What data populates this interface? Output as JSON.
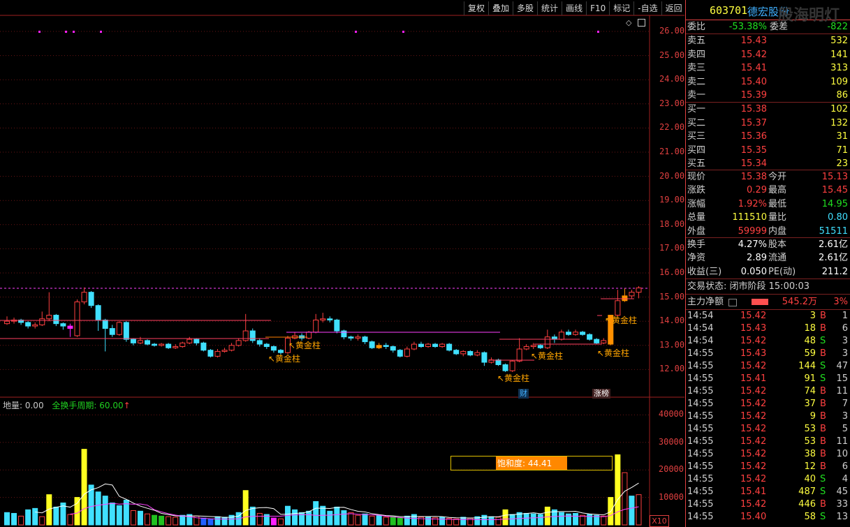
{
  "toolbar": [
    "复权",
    "叠加",
    "多股",
    "统计",
    "画线",
    "F10",
    "标记",
    "-自选",
    "返回"
  ],
  "price_axis": [
    "26.00",
    "25.00",
    "24.00",
    "23.00",
    "22.00",
    "21.00",
    "20.00",
    "19.00",
    "18.00",
    "17.00",
    "16.00",
    "15.00",
    "14.00",
    "13.00",
    "12.00"
  ],
  "volume_axis": [
    "40000",
    "30000",
    "20000",
    "10000"
  ],
  "volume_header": {
    "label": "地量: 0.00",
    "indicator": "全换手周期: 60.00",
    "arrow": "↑"
  },
  "golden_labels": [
    "↖黄金柱",
    "↖黄金柱",
    "↖黄金柱",
    "↖黄金柱",
    "↖黄金柱",
    "↖黄金柱"
  ],
  "event_tags": {
    "cai": "财",
    "zhangbang": "涨榜"
  },
  "saturation": "饱和度: 44.41",
  "x10_label": "X10",
  "stock": {
    "code": "603701",
    "name": "德宏股份",
    "watermark": "股海明灯"
  },
  "weibi": {
    "label1": "委比",
    "value1": "-53.38%",
    "label2": "委差",
    "value2": "-822"
  },
  "asks": [
    {
      "label": "卖五",
      "price": "15.43",
      "vol": "532"
    },
    {
      "label": "卖四",
      "price": "15.42",
      "vol": "141"
    },
    {
      "label": "卖三",
      "price": "15.41",
      "vol": "313"
    },
    {
      "label": "卖二",
      "price": "15.40",
      "vol": "109"
    },
    {
      "label": "卖一",
      "price": "15.39",
      "vol": "86"
    }
  ],
  "bids": [
    {
      "label": "买一",
      "price": "15.38",
      "vol": "102"
    },
    {
      "label": "买二",
      "price": "15.37",
      "vol": "132"
    },
    {
      "label": "买三",
      "price": "15.36",
      "vol": "31"
    },
    {
      "label": "买四",
      "price": "15.35",
      "vol": "71"
    },
    {
      "label": "买五",
      "price": "15.34",
      "vol": "23"
    }
  ],
  "quote": [
    {
      "l1": "现价",
      "v1": "15.38",
      "l2": "今开",
      "v2": "15.13"
    },
    {
      "l1": "涨跌",
      "v1": "0.29",
      "l2": "最高",
      "v2": "15.45"
    },
    {
      "l1": "涨幅",
      "v1": "1.92%",
      "l2": "最低",
      "v2": "14.95"
    },
    {
      "l1": "总量",
      "v1": "111510",
      "l2": "量比",
      "v2": "0.80"
    },
    {
      "l1": "外盘",
      "v1": "59999",
      "l2": "内盘",
      "v2": "51511"
    }
  ],
  "fundamentals": [
    {
      "l1": "换手",
      "v1": "4.27%",
      "l2": "股本",
      "v2": "2.61亿"
    },
    {
      "l1": "净资",
      "v1": "2.89",
      "l2": "流通",
      "v2": "2.61亿"
    },
    {
      "l1": "收益(三)",
      "v1": "0.050",
      "l2": "PE(动)",
      "v2": "211.2"
    }
  ],
  "trade_state": "交易状态: 闭市阶段 15:00:03",
  "main_flow": {
    "label": "主力净额",
    "value": "545.2万",
    "pct": "3%"
  },
  "ticks": [
    {
      "t": "14:54",
      "p": "15.42",
      "v": "3",
      "bs": "B",
      "n": "1"
    },
    {
      "t": "14:54",
      "p": "15.43",
      "v": "18",
      "bs": "B",
      "n": "6"
    },
    {
      "t": "14:54",
      "p": "15.42",
      "v": "48",
      "bs": "S",
      "n": "3"
    },
    {
      "t": "14:55",
      "p": "15.43",
      "v": "59",
      "bs": "B",
      "n": "3"
    },
    {
      "t": "14:55",
      "p": "15.42",
      "v": "144",
      "bs": "S",
      "n": "47"
    },
    {
      "t": "14:55",
      "p": "15.41",
      "v": "91",
      "bs": "S",
      "n": "15"
    },
    {
      "t": "14:55",
      "p": "15.42",
      "v": "74",
      "bs": "B",
      "n": "11"
    },
    {
      "t": "14:55",
      "p": "15.42",
      "v": "37",
      "bs": "B",
      "n": "7"
    },
    {
      "t": "14:55",
      "p": "15.42",
      "v": "9",
      "bs": "B",
      "n": "3"
    },
    {
      "t": "14:55",
      "p": "15.42",
      "v": "53",
      "bs": "B",
      "n": "5"
    },
    {
      "t": "14:55",
      "p": "15.42",
      "v": "53",
      "bs": "B",
      "n": "11"
    },
    {
      "t": "14:55",
      "p": "15.42",
      "v": "38",
      "bs": "B",
      "n": "10"
    },
    {
      "t": "14:55",
      "p": "15.42",
      "v": "12",
      "bs": "B",
      "n": "6"
    },
    {
      "t": "14:55",
      "p": "15.42",
      "v": "40",
      "bs": "S",
      "n": "4"
    },
    {
      "t": "14:55",
      "p": "15.41",
      "v": "487",
      "bs": "S",
      "n": "45"
    },
    {
      "t": "14:55",
      "p": "15.42",
      "v": "446",
      "bs": "B",
      "n": "33"
    },
    {
      "t": "14:55",
      "p": "15.40",
      "v": "58",
      "bs": "S",
      "n": "13"
    }
  ],
  "candles": [
    [
      13.9,
      14.0,
      14.2,
      13.85
    ],
    [
      14.0,
      14.05,
      14.15,
      13.9
    ],
    [
      14.05,
      13.95,
      14.1,
      13.85
    ],
    [
      13.95,
      13.8,
      14.0,
      13.7
    ],
    [
      13.8,
      13.85,
      13.95,
      13.7
    ],
    [
      13.85,
      14.1,
      14.4,
      13.8
    ],
    [
      14.1,
      14.25,
      15.2,
      14.0
    ],
    [
      14.25,
      13.9,
      14.3,
      13.8
    ],
    [
      13.9,
      13.8,
      13.95,
      13.65
    ],
    [
      13.8,
      13.7,
      13.9,
      13.35
    ],
    [
      13.4,
      14.8,
      14.9,
      13.35
    ],
    [
      14.8,
      15.2,
      15.4,
      14.7
    ],
    [
      15.2,
      14.65,
      15.25,
      14.55
    ],
    [
      14.65,
      14.05,
      14.7,
      13.6
    ],
    [
      14.05,
      13.7,
      14.1,
      12.75
    ],
    [
      13.7,
      13.45,
      13.85,
      13.35
    ],
    [
      13.45,
      13.95,
      14.0,
      13.4
    ],
    [
      13.95,
      13.25,
      14.0,
      13.15
    ],
    [
      13.25,
      13.1,
      13.3,
      13.0
    ],
    [
      13.1,
      13.2,
      13.35,
      13.05
    ],
    [
      13.2,
      13.05,
      13.25,
      13.0
    ],
    [
      13.05,
      13.0,
      13.1,
      12.95
    ],
    [
      13.0,
      13.05,
      13.1,
      12.95
    ],
    [
      13.05,
      12.9,
      13.1,
      12.85
    ],
    [
      12.9,
      12.95,
      13.05,
      12.85
    ],
    [
      12.95,
      13.1,
      13.15,
      12.9
    ],
    [
      13.1,
      13.25,
      13.35,
      13.05
    ],
    [
      13.25,
      13.1,
      13.3,
      13.0
    ],
    [
      13.1,
      12.8,
      13.15,
      12.75
    ],
    [
      12.8,
      12.55,
      12.85,
      12.5
    ],
    [
      12.55,
      12.75,
      12.85,
      12.5
    ],
    [
      12.75,
      12.8,
      12.9,
      12.7
    ],
    [
      12.8,
      13.0,
      13.1,
      12.75
    ],
    [
      13.0,
      13.2,
      13.3,
      12.95
    ],
    [
      13.2,
      13.6,
      14.3,
      13.15
    ],
    [
      13.6,
      13.2,
      13.7,
      13.1
    ],
    [
      13.2,
      13.05,
      13.3,
      12.95
    ],
    [
      13.05,
      12.95,
      13.1,
      12.85
    ],
    [
      12.95,
      12.8,
      13.0,
      12.7
    ],
    [
      12.8,
      12.7,
      12.85,
      12.6
    ],
    [
      12.7,
      13.3,
      13.4,
      12.65
    ],
    [
      13.3,
      13.4,
      13.55,
      13.25
    ],
    [
      13.4,
      13.3,
      13.5,
      13.2
    ],
    [
      13.3,
      13.55,
      13.6,
      13.25
    ],
    [
      13.55,
      14.05,
      14.3,
      13.5
    ],
    [
      14.05,
      14.1,
      14.35,
      13.95
    ],
    [
      14.1,
      14.05,
      14.2,
      13.95
    ],
    [
      14.05,
      13.6,
      14.1,
      13.5
    ],
    [
      13.6,
      13.35,
      13.65,
      13.25
    ],
    [
      13.35,
      13.3,
      13.4,
      13.2
    ],
    [
      13.3,
      13.35,
      13.45,
      13.2
    ],
    [
      13.35,
      13.15,
      13.4,
      13.05
    ],
    [
      13.15,
      12.9,
      13.2,
      12.85
    ],
    [
      12.9,
      13.0,
      13.1,
      12.85
    ],
    [
      13.0,
      12.95,
      13.1,
      12.85
    ],
    [
      12.95,
      12.8,
      13.0,
      12.7
    ],
    [
      12.8,
      12.55,
      12.85,
      12.5
    ],
    [
      12.55,
      12.85,
      12.95,
      12.5
    ],
    [
      12.85,
      13.05,
      13.15,
      12.8
    ],
    [
      13.05,
      12.95,
      13.15,
      12.9
    ],
    [
      12.95,
      13.05,
      13.1,
      12.9
    ],
    [
      13.05,
      12.95,
      13.1,
      12.9
    ],
    [
      12.95,
      13.05,
      13.1,
      12.9
    ],
    [
      13.05,
      12.8,
      13.1,
      12.75
    ],
    [
      12.8,
      12.65,
      12.85,
      12.6
    ],
    [
      12.65,
      12.75,
      12.8,
      12.55
    ],
    [
      12.75,
      12.6,
      12.8,
      12.55
    ],
    [
      12.6,
      12.7,
      12.8,
      12.55
    ],
    [
      12.7,
      12.3,
      12.75,
      12.15
    ],
    [
      12.3,
      12.4,
      12.5,
      12.25
    ],
    [
      12.4,
      12.2,
      12.45,
      12.15
    ],
    [
      12.2,
      11.95,
      12.25,
      11.9
    ],
    [
      11.95,
      12.35,
      12.4,
      11.9
    ],
    [
      12.35,
      12.85,
      13.3,
      12.3
    ],
    [
      12.85,
      12.95,
      13.05,
      12.8
    ],
    [
      12.95,
      13.0,
      13.1,
      12.85
    ],
    [
      13.0,
      12.9,
      13.05,
      12.85
    ],
    [
      12.9,
      13.35,
      13.65,
      12.85
    ],
    [
      13.35,
      13.25,
      13.45,
      13.1
    ],
    [
      13.25,
      13.55,
      13.65,
      13.2
    ],
    [
      13.55,
      13.45,
      13.65,
      13.4
    ],
    [
      13.45,
      13.55,
      13.65,
      13.4
    ],
    [
      13.55,
      13.45,
      13.6,
      13.4
    ],
    [
      13.45,
      13.25,
      13.5,
      13.2
    ],
    [
      13.25,
      13.1,
      13.3,
      13.05
    ],
    [
      13.1,
      13.2,
      13.3,
      13.05
    ],
    [
      13.05,
      14.25,
      14.25,
      13.0
    ],
    [
      14.25,
      14.85,
      15.3,
      14.2
    ],
    [
      14.85,
      15.05,
      15.35,
      14.8
    ],
    [
      15.05,
      15.2,
      15.3,
      14.95
    ],
    [
      15.2,
      15.38,
      15.45,
      14.95
    ]
  ],
  "volumes": [
    [
      4500,
      "u"
    ],
    [
      4200,
      "u"
    ],
    [
      3200,
      "d"
    ],
    [
      5500,
      "u"
    ],
    [
      6000,
      "u"
    ],
    [
      3000,
      "d"
    ],
    [
      11000,
      "y"
    ],
    [
      6500,
      "u"
    ],
    [
      8000,
      "u"
    ],
    [
      3800,
      "d"
    ],
    [
      10000,
      "y"
    ],
    [
      27500,
      "y"
    ],
    [
      14500,
      "u"
    ],
    [
      12000,
      "u"
    ],
    [
      10500,
      "u"
    ],
    [
      8000,
      "u"
    ],
    [
      7000,
      "u"
    ],
    [
      9000,
      "u"
    ],
    [
      5200,
      "d"
    ],
    [
      5000,
      "u"
    ],
    [
      4000,
      "d"
    ],
    [
      3500,
      "g"
    ],
    [
      3200,
      "g"
    ],
    [
      3000,
      "d"
    ],
    [
      2800,
      "d"
    ],
    [
      3500,
      "u"
    ],
    [
      3800,
      "u"
    ],
    [
      3200,
      "d"
    ],
    [
      2500,
      "b"
    ],
    [
      2200,
      "b"
    ],
    [
      3000,
      "u"
    ],
    [
      2800,
      "u"
    ],
    [
      3500,
      "u"
    ],
    [
      4500,
      "u"
    ],
    [
      12500,
      "y"
    ],
    [
      6500,
      "u"
    ],
    [
      4200,
      "d"
    ],
    [
      3800,
      "u"
    ],
    [
      2500,
      "m"
    ],
    [
      2200,
      "d"
    ],
    [
      6800,
      "u"
    ],
    [
      5500,
      "u"
    ],
    [
      4500,
      "u"
    ],
    [
      5000,
      "u"
    ],
    [
      8500,
      "u"
    ],
    [
      6800,
      "u"
    ],
    [
      5000,
      "u"
    ],
    [
      6500,
      "u"
    ],
    [
      5200,
      "u"
    ],
    [
      4500,
      "d"
    ],
    [
      3500,
      "d"
    ],
    [
      4000,
      "u"
    ],
    [
      3200,
      "d"
    ],
    [
      3500,
      "u"
    ],
    [
      2800,
      "d"
    ],
    [
      3000,
      "g"
    ],
    [
      2500,
      "g"
    ],
    [
      3200,
      "u"
    ],
    [
      3800,
      "u"
    ],
    [
      2800,
      "d"
    ],
    [
      3000,
      "u"
    ],
    [
      2600,
      "d"
    ],
    [
      2800,
      "u"
    ],
    [
      2400,
      "d"
    ],
    [
      2200,
      "d"
    ],
    [
      2800,
      "u"
    ],
    [
      2400,
      "d"
    ],
    [
      3000,
      "u"
    ],
    [
      3500,
      "u"
    ],
    [
      3000,
      "u"
    ],
    [
      2800,
      "d"
    ],
    [
      5500,
      "y"
    ],
    [
      3800,
      "u"
    ],
    [
      4500,
      "u"
    ],
    [
      4200,
      "u"
    ],
    [
      4000,
      "u"
    ],
    [
      3800,
      "u"
    ],
    [
      6500,
      "y"
    ],
    [
      5500,
      "u"
    ],
    [
      4500,
      "u"
    ],
    [
      4000,
      "u"
    ],
    [
      4200,
      "u"
    ],
    [
      3500,
      "d"
    ],
    [
      3800,
      "u"
    ],
    [
      3500,
      "u"
    ],
    [
      3200,
      "d"
    ],
    [
      10000,
      "y"
    ],
    [
      25500,
      "y"
    ],
    [
      19000,
      "d"
    ],
    [
      10500,
      "u"
    ],
    [
      11000,
      "d"
    ]
  ],
  "golden_bars": [
    23,
    28,
    53,
    71,
    86,
    88
  ],
  "magenta_bars": [
    9,
    86
  ],
  "tick_dots": [
    [
      55,
      44
    ],
    [
      93,
      44
    ],
    [
      104,
      44
    ],
    [
      143,
      44
    ],
    [
      508,
      44
    ],
    [
      576,
      44
    ],
    [
      855,
      44
    ]
  ]
}
